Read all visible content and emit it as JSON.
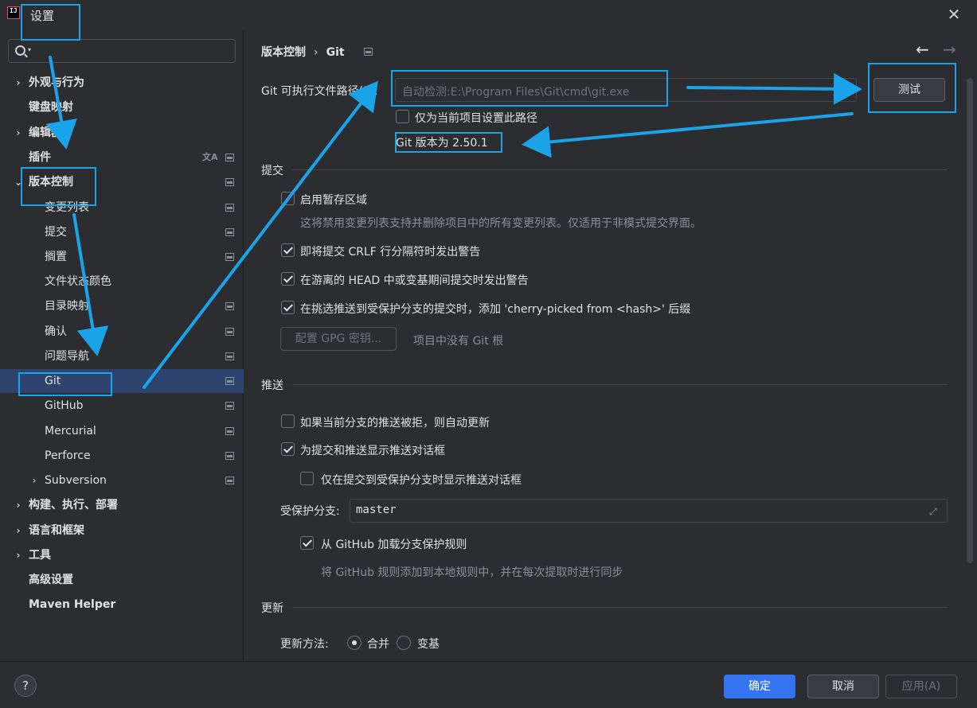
{
  "window": {
    "title": "设置",
    "close_glyph": "✕",
    "logo_text": "IJ"
  },
  "search": {
    "placeholder": ""
  },
  "sidebar": {
    "items": [
      {
        "label": "外观与行为",
        "expandable": true
      },
      {
        "label": "键盘映射"
      },
      {
        "label": "编辑器",
        "expandable": true
      },
      {
        "label": "插件",
        "has_translate_icon": true,
        "has_project_icon": true
      },
      {
        "label": "版本控制",
        "expanded": true,
        "has_project_icon": true
      },
      {
        "label": "变更列表",
        "has_project_icon": true
      },
      {
        "label": "提交",
        "has_project_icon": true
      },
      {
        "label": "搁置",
        "has_project_icon": true
      },
      {
        "label": "文件状态颜色"
      },
      {
        "label": "目录映射",
        "has_project_icon": true
      },
      {
        "label": "确认",
        "has_project_icon": true
      },
      {
        "label": "问题导航",
        "has_project_icon": true
      },
      {
        "label": "Git",
        "selected": true,
        "has_project_icon": true
      },
      {
        "label": "GitHub",
        "has_project_icon": true
      },
      {
        "label": "Mercurial",
        "has_project_icon": true
      },
      {
        "label": "Perforce",
        "has_project_icon": true
      },
      {
        "label": "Subversion",
        "expandable": true,
        "has_project_icon": true
      },
      {
        "label": "构建、执行、部署",
        "expandable": true
      },
      {
        "label": "语言和框架",
        "expandable": true
      },
      {
        "label": "工具",
        "expandable": true
      },
      {
        "label": "高级设置"
      },
      {
        "label": "Maven Helper"
      }
    ]
  },
  "breadcrumb": {
    "parent": "版本控制",
    "separator": "›",
    "current": "Git"
  },
  "nav": {
    "back": "←",
    "forward": "→"
  },
  "git_path": {
    "label": "Git 可执行文件路径(P):",
    "placeholder": "自动检测:E:\\Program Files\\Git\\cmd\\git.exe",
    "test_button": "测试",
    "project_only_label": "仅为当前项目设置此路径",
    "project_only_checked": false,
    "version_text": "Git 版本为 2.50.1"
  },
  "commit_section": {
    "title": "提交",
    "staging_label": "启用暂存区域",
    "staging_checked": false,
    "staging_desc": "这将禁用变更列表支持并删除项目中的所有变更列表。仅适用于非模式提交界面。",
    "crlf_label": "即将提交 CRLF 行分隔符时发出警告",
    "crlf_checked": true,
    "detached_label": "在游离的 HEAD 中或变基期间提交时发出警告",
    "detached_checked": true,
    "cherry_label": "在挑选推送到受保护分支的提交时，添加 'cherry-picked from <hash>' 后缀",
    "cherry_checked": true,
    "gpg_button": "配置 GPG 密钥...",
    "gpg_note": "项目中没有 Git 根"
  },
  "push_section": {
    "title": "推送",
    "auto_update_label": "如果当前分支的推送被拒，则自动更新",
    "auto_update_checked": false,
    "show_dialog_label": "为提交和推送显示推送对话框",
    "show_dialog_checked": true,
    "protected_only_label": "仅在提交到受保护分支时显示推送对话框",
    "protected_only_checked": false,
    "protected_branches_label": "受保护分支:",
    "protected_branches_value": "master",
    "github_rules_label": "从 GitHub 加载分支保护规则",
    "github_rules_checked": true,
    "github_rules_desc": "将 GitHub 规则添加到本地规则中，并在每次提取时进行同步"
  },
  "update_section": {
    "title": "更新",
    "method_label": "更新方法:",
    "options": [
      {
        "label": "合并",
        "checked": true
      },
      {
        "label": "变基",
        "checked": false
      }
    ]
  },
  "footer": {
    "help": "?",
    "ok": "确定",
    "cancel": "取消",
    "apply": "应用(A)"
  },
  "annotation": {
    "color": "#1aa3e8"
  }
}
